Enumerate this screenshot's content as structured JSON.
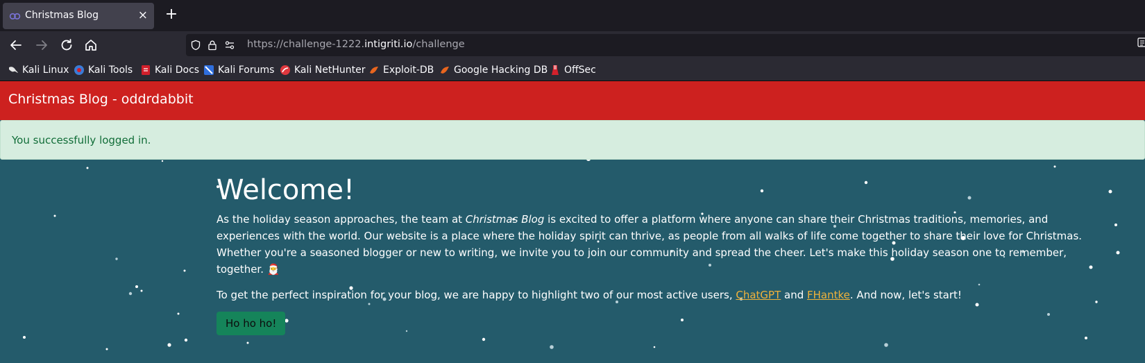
{
  "browser": {
    "tab_title": "Christmas Blog",
    "tab_close": "×",
    "new_tab": "+",
    "url": {
      "scheme": "https://",
      "subdomain": "challenge-1222.",
      "host": "intigriti.io",
      "path": "/challenge"
    },
    "bookmarks": [
      {
        "label": "Kali Linux",
        "icon": "kali-dragon-icon",
        "color": "#ffffff"
      },
      {
        "label": "Kali Tools",
        "icon": "kali-tools-icon",
        "color": "#3b7bd6"
      },
      {
        "label": "Kali Docs",
        "icon": "kali-docs-icon",
        "color": "#d21f2b"
      },
      {
        "label": "Kali Forums",
        "icon": "kali-forums-icon",
        "color": "#2f6fde"
      },
      {
        "label": "Kali NetHunter",
        "icon": "nethunter-icon",
        "color": "#e0383e"
      },
      {
        "label": "Exploit-DB",
        "icon": "exploit-db-icon",
        "color": "#e8651e"
      },
      {
        "label": "Google Hacking DB",
        "icon": "ghdb-icon",
        "color": "#e8651e"
      },
      {
        "label": "OffSec",
        "icon": "offsec-icon",
        "color": "#d3212c"
      }
    ]
  },
  "site": {
    "header_title": "Christmas Blog - oddrdabbit",
    "alert": "You successfully logged in.",
    "welcome": "Welcome!",
    "intro": {
      "before": "As the holiday season approaches, the team at ",
      "emphasis": "Christmas Blog",
      "after": " is excited to offer a platform where anyone can share their Christmas traditions, memories, and experiences with the world. Our website is a place where the holiday spirit can thrive, as people from all walks of life come together to share their love for Christmas. Whether you're a seasoned blogger or new to writing, we invite you to join our community and spread the cheer. Let's make this holiday season one to remember, together. 🎅"
    },
    "highlight": {
      "before": "To get the perfect inspiration for your blog, we are happy to highlight two of our most active users, ",
      "user1": "ChatGPT",
      "middle": " and ",
      "user2": "FHantke",
      "after": ". And now, let's start!"
    },
    "button": "Ho ho ho!",
    "colors": {
      "header": "#cd211f",
      "background": "#245b6b",
      "alert_bg": "#d6eddf",
      "alert_text": "#116d38",
      "link": "#f0b23b",
      "button": "#15845a"
    }
  }
}
